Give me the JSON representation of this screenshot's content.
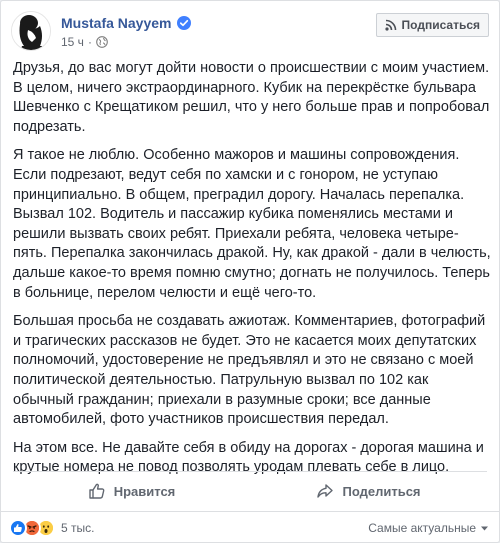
{
  "post": {
    "author": "Mustafa Nayyem",
    "time": "15 ч",
    "subscribe_label": "Подписаться",
    "paragraphs": [
      "Друзья, до вас могут дойти новости о происшествии с моим участием. В целом, ничего экстраординарного. Кубик на перекрёстке бульвара Шевченко с Крещатиком решил, что у него больше прав и попробовал подрезать.",
      "Я такое не люблю. Особенно мажоров и машины сопровождения. Если подрезают, ведут себя по хамски и с гонором, не уступаю принципиально. В общем, преградил дорогу. Началась перепалка. Вызвал 102. Водитель и пассажир кубика поменялись местами и решили вызвать своих ребят. Приехали ребята, человека четыре-пять. Перепалка закончилась дракой. Ну, как дракой - дали в челюсть, дальше какое-то время помню смутно; догнать не получилось. Теперь в больнице, перелом челюсти и ещё чего-то.",
      "Большая просьба не создавать ажиотаж. Комментариев, фотографий и трагических рассказов не будет. Это не касается моих депутатских полномочий, удостоверение не предъявлял и это не связано с моей политической деятельностью. Патрульную вызвал по 102 как обычный гражданин; приехали в разумные сроки; все данные автомобилей, фото участников происшествия передал.",
      "На этом все. Не давайте себя в обиду на дорогах - дорогая машина и крутые номера не повод позволять уродам плевать себе в лицо."
    ]
  },
  "actions": {
    "like_label": "Нравится",
    "share_label": "Поделиться"
  },
  "footer": {
    "reaction_count": "5 тыс.",
    "sort_label": "Самые актуальные"
  },
  "icons": {
    "like": "thumbs-up-icon",
    "angry": "angry-face-icon",
    "wow": "wow-face-icon",
    "rss": "rss-icon",
    "globe": "globe-icon",
    "verified": "verified-check-icon",
    "share": "share-arrow-icon"
  },
  "colors": {
    "link_blue": "#365899",
    "verified_blue": "#4080ff",
    "like_blue": "#1877f2",
    "angry_orange": "#f0683a",
    "wow_yellow": "#fbcd45",
    "text": "#1d2129",
    "muted": "#616770"
  }
}
